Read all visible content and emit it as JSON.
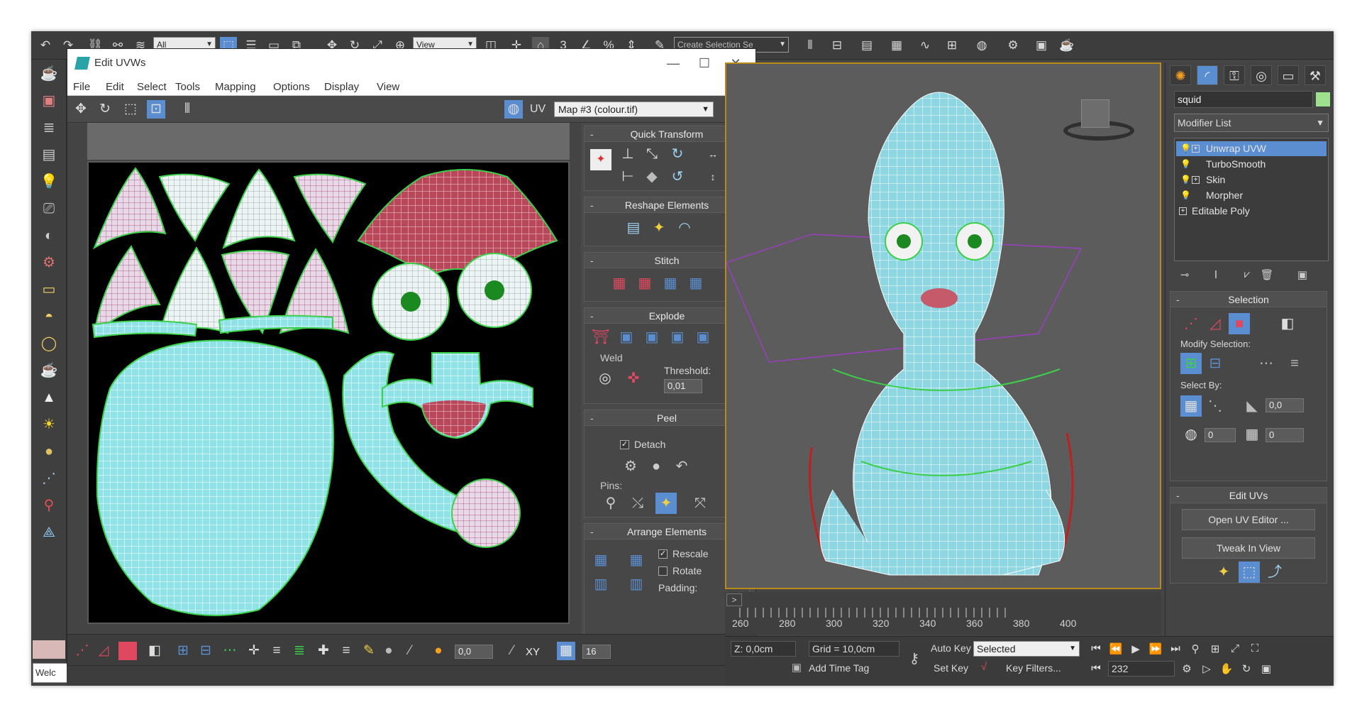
{
  "toolbar": {
    "selection_filter": "All",
    "reference_coord": "View",
    "snap_value": "3",
    "selection_set_placeholder": "Create Selection Se"
  },
  "listener": {
    "text": "Welc"
  },
  "uvw_window": {
    "title": "Edit UVWs",
    "menu": [
      "File",
      "Edit",
      "Select",
      "Tools",
      "Mapping",
      "Options",
      "Display",
      "View"
    ],
    "uv_label": "UV",
    "map_selected": "Map #3 (colour.tif)",
    "rollouts": {
      "quick_transform": "Quick Transform",
      "reshape_elements": "Reshape Elements",
      "stitch": "Stitch",
      "explode": "Explode",
      "weld_label": "Weld",
      "threshold_label": "Threshold:",
      "threshold_value": "0,01",
      "peel": "Peel",
      "detach_label": "Detach",
      "pins_label": "Pins:",
      "arrange_elements": "Arrange Elements",
      "rescale_label": "Rescale",
      "rotate_label": "Rotate",
      "padding_label": "Padding:"
    },
    "bottom_value": "0,0",
    "bottom_xy": "XY",
    "bottom_grid_count": "16"
  },
  "timeline": {
    "ticks": [
      "260",
      "280",
      "300",
      "320",
      "340",
      "360",
      "380",
      "400"
    ]
  },
  "status": {
    "z_value": "Z: 0,0cm",
    "grid": "Grid = 10,0cm",
    "add_time_tag": "Add Time Tag",
    "auto_key": "Auto Key",
    "set_key": "Set Key",
    "key_mode": "Selected",
    "key_filters": "Key Filters...",
    "frame": "232"
  },
  "command_panel": {
    "object_name": "squid",
    "object_color": "#9fe08f",
    "modifier_list": "Modifier List",
    "stack": [
      {
        "label": "Unwrap UVW",
        "selected": true,
        "expandable": true
      },
      {
        "label": "TurboSmooth",
        "selected": false,
        "expandable": false
      },
      {
        "label": "Skin",
        "selected": false,
        "expandable": true
      },
      {
        "label": "Morpher",
        "selected": false,
        "expandable": false
      },
      {
        "label": "Editable Poly",
        "selected": false,
        "expandable": true
      }
    ],
    "selection_rollout": "Selection",
    "modify_selection": "Modify Selection:",
    "select_by": "Select By:",
    "select_by_angle": "0,0",
    "select_by_val1": "0",
    "select_by_val2": "0",
    "edit_uvs_rollout": "Edit UVs",
    "open_uv_editor": "Open UV Editor ...",
    "tweak_in_view": "Tweak In View"
  },
  "colors": {
    "uv_cyan": "#8fe3e6",
    "uv_red": "#b8475a",
    "uv_seam": "#3cd04a",
    "viewport_border": "#b88a18",
    "stack_selected": "#5a8ed1"
  }
}
